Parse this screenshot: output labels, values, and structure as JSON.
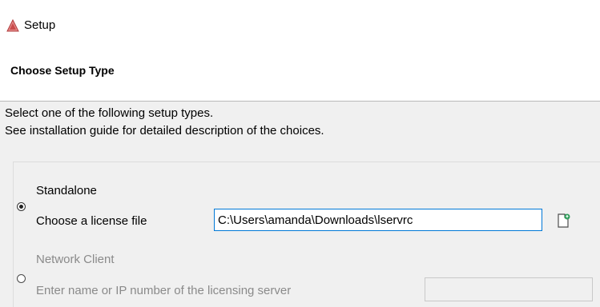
{
  "window": {
    "title": "Setup"
  },
  "header": {
    "title": "Choose Setup Type"
  },
  "description": {
    "line1": "Select one of the following setup types.",
    "line2": "See installation guide for detailed description of the choices."
  },
  "standalone": {
    "label": "Standalone",
    "selected": true,
    "license_label": "Choose a license file",
    "license_value": "C:\\Users\\amanda\\Downloads\\lservrc"
  },
  "network_client": {
    "label": "Network Client",
    "selected": false,
    "server_label": "Enter name or IP number of the licensing server",
    "server_value": ""
  },
  "icons": {
    "app": "installer-triangle-icon",
    "browse": "open-file-icon"
  },
  "colors": {
    "focus_border": "#0078d7",
    "content_bg": "#f0f0f0",
    "disabled_text": "#8a8a8a"
  }
}
